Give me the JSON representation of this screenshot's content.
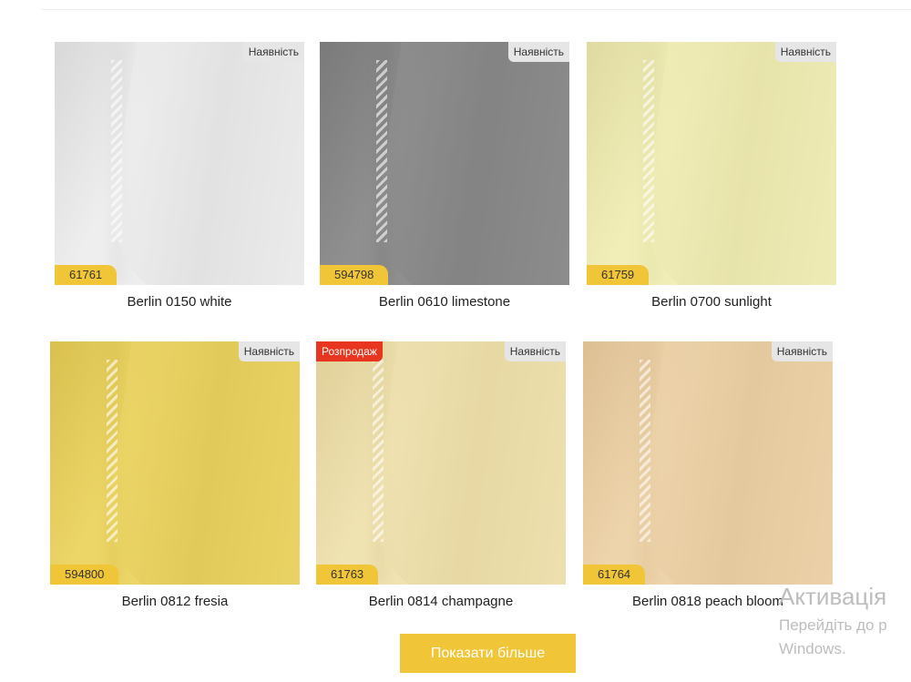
{
  "products": [
    {
      "title": "Berlin 0150 white",
      "code": "61761",
      "stock": "Наявність",
      "sale": "",
      "color": "#eeeeee",
      "shade": "#d8d8d8"
    },
    {
      "title": "Berlin 0610 limestone",
      "code": "594798",
      "stock": "Наявність",
      "sale": "",
      "color": "#8f8f8f",
      "shade": "#7a7a7a"
    },
    {
      "title": "Berlin 0700 sunlight",
      "code": "61759",
      "stock": "Наявність",
      "sale": "",
      "color": "#f1eeb8",
      "shade": "#dedaa0"
    },
    {
      "title": "Berlin 0812 fresia",
      "code": "594800",
      "stock": "Наявність",
      "sale": "",
      "color": "#ecd667",
      "shade": "#d9c04f"
    },
    {
      "title": "Berlin 0814 champagne",
      "code": "61763",
      "stock": "Наявність",
      "sale": "Розпродаж",
      "color": "#f0e3b2",
      "shade": "#dfcf98"
    },
    {
      "title": "Berlin 0818 peach bloom",
      "code": "61764",
      "stock": "Наявність",
      "sale": "",
      "color": "#eed4ab",
      "shade": "#ddbf93"
    }
  ],
  "more_button": "Показати більше",
  "activation": {
    "title": "Активація",
    "line1": "Перейдіть до р",
    "line2": "Windows."
  },
  "colors": {
    "accent": "#f0c537",
    "sale": "#e8351f"
  }
}
